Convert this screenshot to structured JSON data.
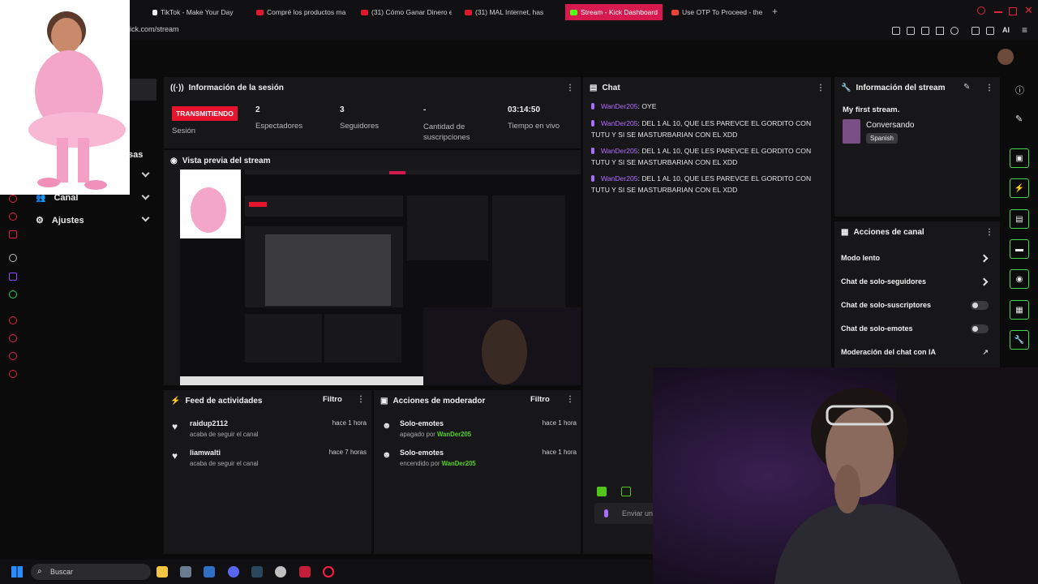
{
  "browser": {
    "tabs": [
      {
        "label": "TikTok - Make Your Day",
        "active": false
      },
      {
        "label": "Compré los productos ma",
        "active": false
      },
      {
        "label": "(31) Cómo Ganar Dinero e",
        "active": false
      },
      {
        "label": "(31) MAL Internet, has",
        "active": false
      },
      {
        "label": "Stream - Kick Dashboard",
        "active": true
      },
      {
        "label": "Use OTP To Proceed - the",
        "active": false
      }
    ],
    "url": "ick.com/stream",
    "ai_label": "AI"
  },
  "sidebar": {
    "partial_label": "sas",
    "items": [
      {
        "label": "Canal",
        "icon": "people-icon"
      },
      {
        "label": "Ajustes",
        "icon": "gear-icon"
      }
    ]
  },
  "session": {
    "title": "Información de la sesión",
    "status": "TRANSMITIENDO",
    "status_label": "Sesión",
    "stats": [
      {
        "value": "2",
        "label": "Espectadores"
      },
      {
        "value": "3",
        "label": "Seguidores"
      },
      {
        "value": "-",
        "label": "Cantidad de suscripciones"
      },
      {
        "value": "03:14:50",
        "label": "Tiempo en vivo"
      }
    ]
  },
  "preview": {
    "title": "Vista previa del stream"
  },
  "chat": {
    "title": "Chat",
    "messages": [
      {
        "user": "WanDer205",
        "text": ": OYE"
      },
      {
        "user": "WanDer205",
        "text": ": DEL 1 AL 10, QUE LES PAREVCE EL GORDITO CON TUTU Y SI SE MASTURBARIAN CON EL XDD"
      },
      {
        "user": "WanDer205",
        "text": ": DEL 1 AL 10, QUE LES PAREVCE EL GORDITO CON TUTU Y SI SE MASTURBARIAN CON EL XDD"
      },
      {
        "user": "WanDer205",
        "text": ": DEL 1 AL 10, QUE LES PAREVCE EL GORDITO CON TUTU Y SI SE MASTURBARIAN CON EL XDD"
      }
    ],
    "input_placeholder": "Enviar un"
  },
  "stream_info": {
    "title": "Información del stream",
    "stream_title": "My first stream.",
    "category": "Conversando",
    "language": "Spanish"
  },
  "channel_actions": {
    "title": "Acciones de canal",
    "items": [
      {
        "label": "Modo lento",
        "control": "arrow"
      },
      {
        "label": "Chat de solo-seguidores",
        "control": "arrow"
      },
      {
        "label": "Chat de solo-suscriptores",
        "control": "toggle"
      },
      {
        "label": "Chat de solo-emotes",
        "control": "toggle"
      },
      {
        "label": "Moderación del chat con IA",
        "control": "external"
      }
    ]
  },
  "activity_feed": {
    "title": "Feed de actividades",
    "filter": "Filtro",
    "items": [
      {
        "user": "raidup2112",
        "action": "acaba de seguir el canal",
        "time": "hace 1 hora"
      },
      {
        "user": "liamwalti",
        "action": "acaba de seguir el canal",
        "time": "hace 7 horas"
      }
    ]
  },
  "mod_actions": {
    "title": "Acciones de moderador",
    "filter": "Filtro",
    "items": [
      {
        "action": "Solo-emotes",
        "prefix": "apagado por ",
        "user": "WanDer205",
        "time": "hace 1 hora"
      },
      {
        "action": "Solo-emotes",
        "prefix": "encendido por ",
        "user": "WanDer205",
        "time": "hace 1 hora"
      }
    ]
  },
  "taskbar": {
    "search_placeholder": "Buscar"
  },
  "colors": {
    "accent": "#d61a4f",
    "live": "#e8142d",
    "kick_green": "#53fc18",
    "chat_user": "#b36bff"
  }
}
